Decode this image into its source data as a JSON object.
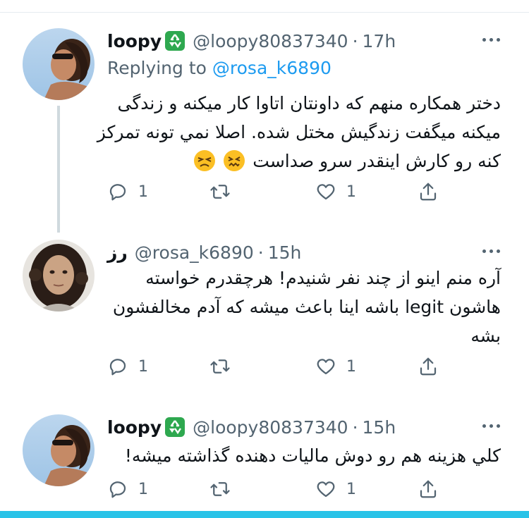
{
  "tweets": [
    {
      "name": "loopy",
      "handle": "@loopy80837340",
      "separator": "·",
      "time": "17h",
      "replying_prefix": "Replying to",
      "replying_to": "@rosa_k6890",
      "text_lines": [
        "دختر همکاره منهم که داونتان اتاوا کار میکنه و زندگی",
        "میکنه میگفت زندگیش مختل شده. اصلا نمي تونه تمرکز",
        "کنه رو کارش اینقدر سرو صداست"
      ],
      "emoji_names": [
        "persevering-face",
        "confounded-face"
      ],
      "badge_icon": "recycle-icon",
      "reply_count": "1",
      "retweet_count": "",
      "like_count": "1"
    },
    {
      "name": "رز",
      "handle": "@rosa_k6890",
      "separator": "·",
      "time": "15h",
      "text_lines": [
        "آره منم اینو از چند نفر شنیدم! هرچقدرم خواسته",
        "هاشون legit باشه اینا باعث میشه که آدم مخالفشون",
        "بشه"
      ],
      "reply_count": "1",
      "retweet_count": "",
      "like_count": "1"
    },
    {
      "name": "loopy",
      "handle": "@loopy80837340",
      "separator": "·",
      "time": "15h",
      "text_lines": [
        "کلي هزینه هم رو دوش مالیات دهنده گذاشته میشه!"
      ],
      "badge_icon": "recycle-icon",
      "reply_count": "1",
      "retweet_count": "",
      "like_count": "1"
    }
  ],
  "colors": {
    "secondary_text": "#536471",
    "link": "#1d9bf0",
    "thread_line": "#cfd9de",
    "bottom_bar": "#29c3e8",
    "badge": "#2ea84f"
  }
}
